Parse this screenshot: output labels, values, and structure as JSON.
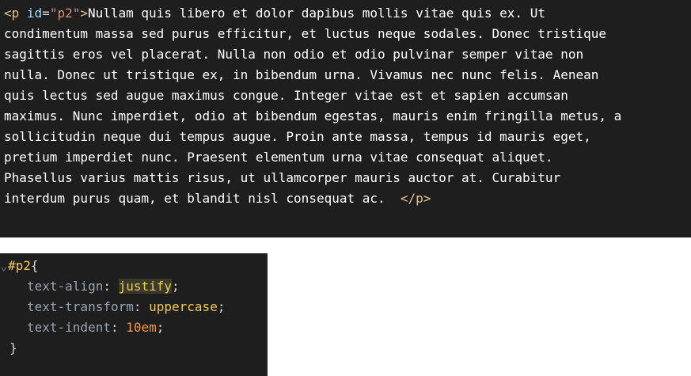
{
  "html_snippet": {
    "open_tag_start": "<p ",
    "attr_name": "id",
    "attr_eq": "=",
    "attr_value": "\"p2\"",
    "open_tag_end": ">",
    "lines": [
      "Nullam quis libero et dolor dapibus mollis vitae quis ex. Ut",
      "condimentum massa sed purus efficitur, et luctus neque sodales. Donec tristique",
      "sagittis eros vel placerat. Nulla non odio et odio pulvinar semper vitae non",
      "nulla. Donec ut tristique ex, in bibendum urna. Vivamus nec nunc felis. Aenean",
      "quis lectus sed augue maximus congue. Integer vitae est et sapien accumsan",
      "maximus. Nunc imperdiet, odio at bibendum egestas, mauris enim fringilla metus, a",
      "sollicitudin neque dui tempus augue. Proin ante massa, tempus id mauris eget,",
      "pretium imperdiet nunc. Praesent elementum urna vitae consequat aliquet.",
      "Phasellus varius mattis risus, ut ullamcorper mauris auctor at. Curabitur",
      "interdum purus quam, et blandit nisl consequat ac.  "
    ],
    "close_tag": "</p>"
  },
  "css_snippet": {
    "gutter": "⌄",
    "selector": "#p2",
    "open_brace": "{",
    "rules": [
      {
        "property": "text-align",
        "colon": ": ",
        "value": "justify",
        "unit": "",
        "semicolon": ";"
      },
      {
        "property": "text-transform",
        "colon": ": ",
        "value": "uppercase",
        "unit": "",
        "semicolon": ";"
      },
      {
        "property": "text-indent",
        "colon": ": ",
        "value": "10",
        "unit": "em",
        "semicolon": ";"
      }
    ],
    "close_brace": "}"
  },
  "colors": {
    "editor_bg": "#1e1e1e",
    "tag": "#e2c08d",
    "attribute": "#9cdcfe",
    "string": "#ce9178",
    "selector": "#f2c94c",
    "property": "#9aa5b1",
    "value": "#f2c94c",
    "number": "#f29b4c"
  }
}
